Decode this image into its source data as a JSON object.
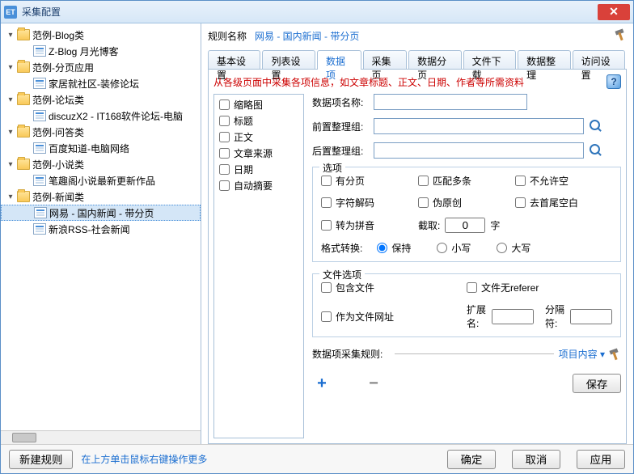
{
  "window": {
    "app_icon_text": "ET",
    "title": "采集配置"
  },
  "tree": {
    "nodes": [
      {
        "level": 0,
        "type": "folder",
        "exp": "▾",
        "label": "范例-Blog类"
      },
      {
        "level": 1,
        "type": "file",
        "exp": "",
        "label": "Z-Blog 月光博客"
      },
      {
        "level": 0,
        "type": "folder",
        "exp": "▾",
        "label": "范例-分页应用"
      },
      {
        "level": 1,
        "type": "file",
        "exp": "",
        "label": "家居就社区-装修论坛"
      },
      {
        "level": 0,
        "type": "folder",
        "exp": "▾",
        "label": "范例-论坛类"
      },
      {
        "level": 1,
        "type": "file",
        "exp": "",
        "label": "discuzX2 - IT168软件论坛-电脑"
      },
      {
        "level": 0,
        "type": "folder",
        "exp": "▾",
        "label": "范例-问答类"
      },
      {
        "level": 1,
        "type": "file",
        "exp": "",
        "label": "百度知道-电脑网络"
      },
      {
        "level": 0,
        "type": "folder",
        "exp": "▾",
        "label": "范例-小说类"
      },
      {
        "level": 1,
        "type": "file",
        "exp": "",
        "label": "笔趣阁小说最新更新作品"
      },
      {
        "level": 0,
        "type": "folder",
        "exp": "▾",
        "label": "范例-新闻类"
      },
      {
        "level": 1,
        "type": "file",
        "exp": "",
        "label": "网易 - 国内新闻 - 带分页",
        "selected": true
      },
      {
        "level": 1,
        "type": "file",
        "exp": "",
        "label": "新浪RSS-社会新闻"
      }
    ]
  },
  "rule_name": {
    "label": "规则名称",
    "value": "网易 - 国内新闻 - 带分页"
  },
  "tabs": [
    "基本设置",
    "列表设置",
    "数据项",
    "采集页",
    "数据分页",
    "文件下载",
    "数据整理",
    "访问设置"
  ],
  "active_tab_index": 2,
  "desc": "从各级页面中采集各项信息，如文章标题、正文、日期、作者等所需资料",
  "data_items": [
    "缩略图",
    "标题",
    "正文",
    "文章来源",
    "日期",
    "自动摘要"
  ],
  "form": {
    "name_label": "数据项名称:",
    "pre_group_label": "前置整理组:",
    "post_group_label": "后置整理组:"
  },
  "options": {
    "legend": "选项",
    "has_paging": "有分页",
    "match_multi": "匹配多条",
    "no_empty": "不允许空",
    "char_decode": "字符解码",
    "fake_orig": "伪原创",
    "trim_blank": "去首尾空白",
    "to_pinyin": "转为拼音",
    "truncate_label": "截取:",
    "truncate_value": "0",
    "truncate_unit": "字",
    "format_label": "格式转换:",
    "keep": "保持",
    "lower": "小写",
    "upper": "大写"
  },
  "file_opts": {
    "legend": "文件选项",
    "include_file": "包含文件",
    "no_referer": "文件无referer",
    "as_file_url": "作为文件网址",
    "ext_label": "扩展名:",
    "sep_label": "分隔符:"
  },
  "collect_rule": {
    "label": "数据项采集规则:",
    "link": "项目内容",
    "arrow": "▾"
  },
  "buttons": {
    "save": "保存",
    "new_rule": "新建规则",
    "ok": "确定",
    "cancel": "取消",
    "apply": "应用"
  },
  "footer_hint": "在上方单击鼠标右键操作更多"
}
